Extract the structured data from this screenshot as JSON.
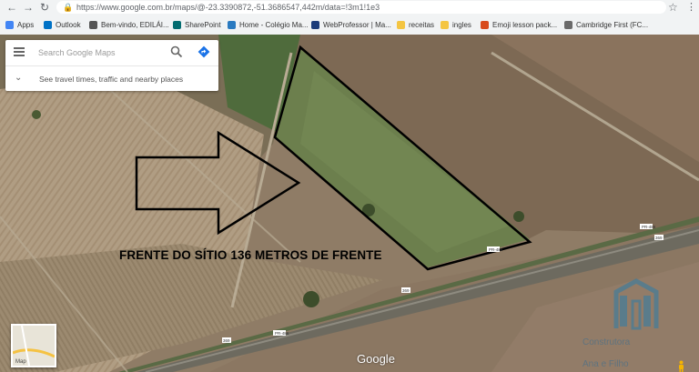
{
  "browser": {
    "url": "https://www.google.com.br/maps/@-23.3390872,-51.3686547,442m/data=!3m1!1e3",
    "bookmarks": [
      {
        "label": "Apps",
        "icon": "apps-grid-icon",
        "color": "#4285f4"
      },
      {
        "label": "Outlook",
        "icon": "outlook-icon",
        "color": "#0072c6"
      },
      {
        "label": "Bem-vindo, EDILÁI...",
        "icon": "page-icon",
        "color": "#555555"
      },
      {
        "label": "SharePoint",
        "icon": "sharepoint-icon",
        "color": "#036c70"
      },
      {
        "label": "Home - Colégio Ma...",
        "icon": "school-icon",
        "color": "#2a7ac0"
      },
      {
        "label": "WebProfessor | Ma...",
        "icon": "webprofessor-icon",
        "color": "#1d3d7a"
      },
      {
        "label": "receitas",
        "icon": "folder-icon",
        "color": "#f4c542"
      },
      {
        "label": "ingles",
        "icon": "folder-icon",
        "color": "#f4c542"
      },
      {
        "label": "Emoji lesson pack...",
        "icon": "emoji-icon",
        "color": "#d84a1b"
      },
      {
        "label": "Cambridge First (FC...",
        "icon": "check-icon",
        "color": "#6b6b6b"
      }
    ]
  },
  "maps": {
    "search_placeholder": "Search Google Maps",
    "travel_text": "See travel times, traffic and nearby places",
    "minimap_label": "Map",
    "google_logo": "Google",
    "road_labels": [
      "PR-486",
      "PR-486",
      "369",
      "369",
      "PR-486",
      "369"
    ]
  },
  "annotation": {
    "caption": "FRENTE DO SÍTIO 136 METROS DE FRENTE"
  },
  "watermark": {
    "line1": "Construtora",
    "line2": "Ana e Filho"
  }
}
